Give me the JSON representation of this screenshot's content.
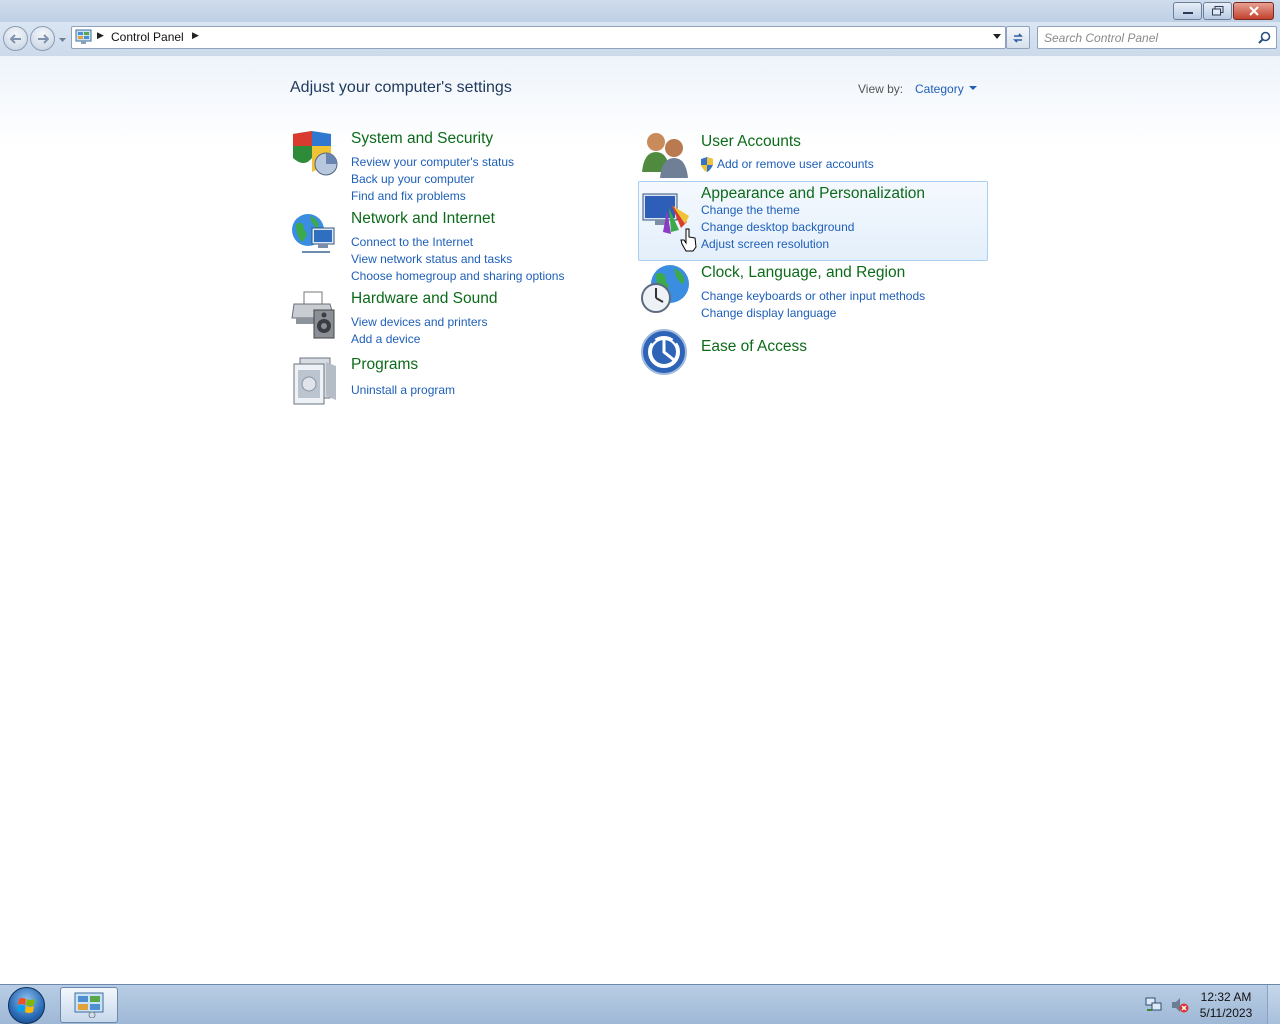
{
  "window": {
    "minimize_icon": "minimize-icon",
    "maximize_icon": "restore-icon",
    "close_icon": "close-icon"
  },
  "nav": {
    "back_icon": "back-arrow-icon",
    "forward_icon": "forward-arrow-icon",
    "breadcrumb": "Control Panel",
    "refresh_icon": "refresh-icon",
    "search_placeholder": "Search Control Panel"
  },
  "main": {
    "title": "Adjust your computer's settings",
    "view_by_label": "View by:",
    "view_by_value": "Category",
    "left_categories": [
      {
        "title": "System and Security",
        "icon": "shield-icon",
        "links": [
          "Review your computer's status",
          "Back up your computer",
          "Find and fix problems"
        ]
      },
      {
        "title": "Network and Internet",
        "icon": "globe-network-icon",
        "links": [
          "Connect to the Internet",
          "View network status and tasks",
          "Choose homegroup and sharing options"
        ]
      },
      {
        "title": "Hardware and Sound",
        "icon": "printer-speaker-icon",
        "links": [
          "View devices and printers",
          "Add a device"
        ]
      },
      {
        "title": "Programs",
        "icon": "programs-icon",
        "links": [
          "Uninstall a program"
        ]
      }
    ],
    "right_categories": [
      {
        "title": "User Accounts",
        "icon": "users-icon",
        "links": [
          "Add or remove user accounts"
        ]
      },
      {
        "title": "Appearance and Personalization",
        "icon": "monitor-colors-icon",
        "links": [
          "Change the theme",
          "Change desktop background",
          "Adjust screen resolution"
        ]
      },
      {
        "title": "Clock, Language, and Region",
        "icon": "clock-globe-icon",
        "links": [
          "Change keyboards or other input methods",
          "Change display language"
        ]
      },
      {
        "title": "Ease of Access",
        "icon": "ease-of-access-icon",
        "links": []
      }
    ]
  },
  "taskbar": {
    "start_icon": "windows-start-icon",
    "task_icon": "control-panel-icon",
    "tray_icons": [
      "network-icon",
      "volume-muted-icon"
    ],
    "time": "12:32 AM",
    "date": "5/11/2023"
  },
  "colors": {
    "category_title": "#0c6b1a",
    "link": "#1e5fb8",
    "hover_border": "#a9cff3"
  }
}
